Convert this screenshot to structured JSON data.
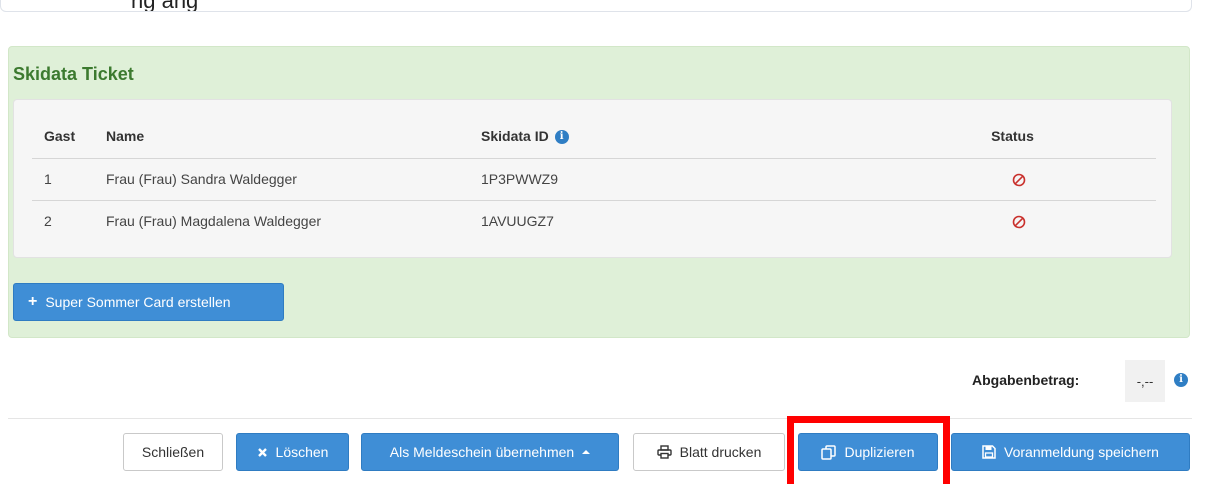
{
  "top": {
    "partial_text": "ng ang"
  },
  "panel": {
    "title": "Skidata Ticket",
    "table": {
      "headers": {
        "gast": "Gast",
        "name": "Name",
        "skidata_id": "Skidata ID",
        "status": "Status"
      },
      "rows": [
        {
          "gast": "1",
          "name": "Frau (Frau) Sandra Waldegger",
          "skidata_id": "1P3PWWZ9",
          "status_icon": "ban-icon"
        },
        {
          "gast": "2",
          "name": "Frau (Frau) Magdalena Waldegger",
          "skidata_id": "1AVUUGZ7",
          "status_icon": "ban-icon"
        }
      ]
    },
    "create_button": {
      "icon": "plus-icon",
      "label": "Super Sommer Card erstellen"
    }
  },
  "fee": {
    "label": "Abgabenbetrag:",
    "value": "-,--"
  },
  "footer": {
    "close_label": "Schließen",
    "delete_label": "Löschen",
    "apply_label": "Als Meldeschein übernehmen",
    "print_label": "Blatt drucken",
    "duplicate_label": "Duplizieren",
    "save_label": "Voranmeldung speichern"
  },
  "colors": {
    "panel_bg": "#dff0d8",
    "title_green": "#3c7a2f",
    "primary_blue": "#3f8ed6",
    "status_red": "#c9302c",
    "highlight_red": "#ff0000"
  }
}
